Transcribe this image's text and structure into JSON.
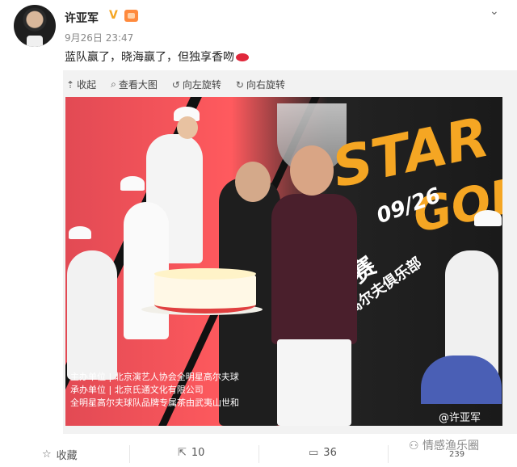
{
  "post": {
    "user_name": "许亚军",
    "vip_badge": "V",
    "timestamp": "9月26日 23:47",
    "text": "蓝队赢了，晓海赢了，但独享香吻"
  },
  "toolbar": {
    "items": [
      {
        "label": "收起",
        "icon": "collapse-up-icon",
        "glyph": "⇡"
      },
      {
        "label": "查看大图",
        "icon": "search-icon",
        "glyph": "⌕"
      },
      {
        "label": "向左旋转",
        "icon": "rotate-left-icon",
        "glyph": "↺"
      },
      {
        "label": "向右旋转",
        "icon": "rotate-right-icon",
        "glyph": "↻"
      }
    ]
  },
  "photo": {
    "star_text": "STAR",
    "gol_text": "GOL",
    "date_text": "09/26",
    "tournament_text": "赛",
    "club_text": "高尔夫俱乐部",
    "sponsor_lines": [
      "主办单位 | 北京演艺人协会全明星高尔夫球",
      "承办单位 | 北京氏通文化有限公司",
      "全明星高尔夫球队品牌专属茶由武夷山世和"
    ],
    "watermark": "@许亚军"
  },
  "actions": {
    "favorite": "收藏",
    "repost": "10",
    "comment": "36",
    "like": "239"
  },
  "brand_watermark": "情感渔乐圈",
  "colors": {
    "accent": "#f5a623",
    "background": "#ffffff",
    "panel": "#f2f2f2"
  }
}
